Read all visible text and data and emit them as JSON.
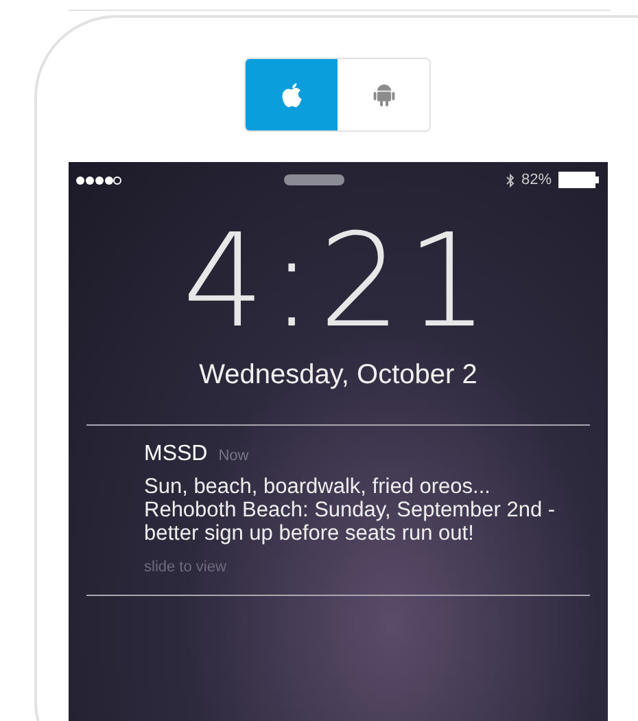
{
  "platform_toggle": [
    {
      "kind": "apple",
      "selected": true
    },
    {
      "kind": "android",
      "selected": false
    }
  ],
  "status_bar": {
    "battery": "82%"
  },
  "lock_screen": {
    "time": "4:21",
    "date": "Wednesday, October 2"
  },
  "notification": {
    "app": "MSSD",
    "time": "Now",
    "message": "Sun, beach, boardwalk, fried oreos... Rehoboth Beach: Sunday, September 2nd - better sign up before seats run out!",
    "hint": "slide to view"
  }
}
